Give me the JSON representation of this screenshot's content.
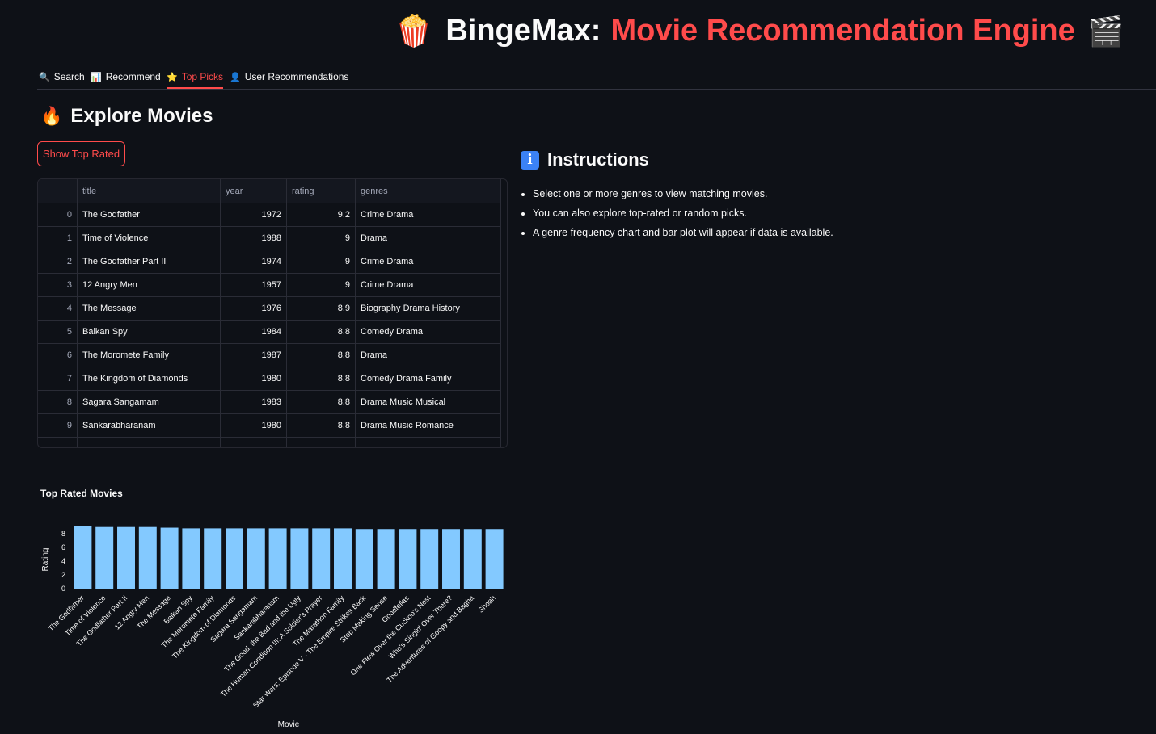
{
  "header": {
    "left_emoji": "🍿",
    "title_white": "BingeMax:",
    "title_red": "Movie Recommendation Engine",
    "right_emoji": "🎬"
  },
  "tabs": [
    {
      "icon": "🔍",
      "label": "Search"
    },
    {
      "icon": "📊",
      "label": "Recommend"
    },
    {
      "icon": "⭐",
      "label": "Top Picks"
    },
    {
      "icon": "👤",
      "label": "User Recommendations"
    }
  ],
  "explore": {
    "icon": "🔥",
    "heading": "Explore Movies",
    "button_label": "Show Top Rated"
  },
  "table": {
    "columns": [
      "title",
      "year",
      "rating",
      "genres"
    ],
    "rows": [
      {
        "index": "0",
        "title": "The Godfather",
        "year": "1972",
        "rating": "9.2",
        "genres": "Crime Drama"
      },
      {
        "index": "1",
        "title": "Time of Violence",
        "year": "1988",
        "rating": "9",
        "genres": "Drama"
      },
      {
        "index": "2",
        "title": "The Godfather Part II",
        "year": "1974",
        "rating": "9",
        "genres": "Crime Drama"
      },
      {
        "index": "3",
        "title": "12 Angry Men",
        "year": "1957",
        "rating": "9",
        "genres": "Crime Drama"
      },
      {
        "index": "4",
        "title": "The Message",
        "year": "1976",
        "rating": "8.9",
        "genres": "Biography Drama History"
      },
      {
        "index": "5",
        "title": "Balkan Spy",
        "year": "1984",
        "rating": "8.8",
        "genres": "Comedy Drama"
      },
      {
        "index": "6",
        "title": "The Moromete Family",
        "year": "1987",
        "rating": "8.8",
        "genres": "Drama"
      },
      {
        "index": "7",
        "title": "The Kingdom of Diamonds",
        "year": "1980",
        "rating": "8.8",
        "genres": "Comedy Drama Family"
      },
      {
        "index": "8",
        "title": "Sagara Sangamam",
        "year": "1983",
        "rating": "8.8",
        "genres": "Drama Music Musical"
      },
      {
        "index": "9",
        "title": "Sankarabharanam",
        "year": "1980",
        "rating": "8.8",
        "genres": "Drama Music Romance"
      }
    ]
  },
  "instructions": {
    "icon": "i",
    "heading": "Instructions",
    "items": [
      "Select one or more genres to view matching movies.",
      "You can also explore top-rated or random picks.",
      "A genre frequency chart and bar plot will appear if data is available."
    ]
  },
  "chart_data": {
    "type": "bar",
    "title": "Top Rated Movies",
    "xlabel": "Movie",
    "ylabel": "Rating",
    "ylim": [
      0,
      9.2
    ],
    "yticks": [
      0,
      2,
      4,
      6,
      8
    ],
    "categories": [
      "The Godfather",
      "Time of Violence",
      "The Godfather Part II",
      "12 Angry Men",
      "The Message",
      "Balkan Spy",
      "The Moromete Family",
      "The Kingdom of Diamonds",
      "Sagara Sangamam",
      "Sankarabharanam",
      "The Good, the Bad and the Ugly",
      "The Human Condition III: A Soldier's Prayer",
      "The Marathon Family",
      "Star Wars: Episode V - The Empire Strikes Back",
      "Stop Making Sense",
      "Goodfellas",
      "One Flew Over the Cuckoo's Nest",
      "Who's Singin' Over There?",
      "The Adventures of Goopy and Bagha",
      "Shoah"
    ],
    "values": [
      9.2,
      9,
      9,
      9,
      8.9,
      8.8,
      8.8,
      8.8,
      8.8,
      8.8,
      8.8,
      8.8,
      8.8,
      8.7,
      8.7,
      8.7,
      8.7,
      8.7,
      8.7,
      8.7
    ],
    "bar_color": "#83c9ff",
    "grid": false
  },
  "colors": {
    "background": "#0e1117",
    "accent": "#ff4b4b",
    "text": "#fafafa",
    "bar": "#83c9ff"
  }
}
